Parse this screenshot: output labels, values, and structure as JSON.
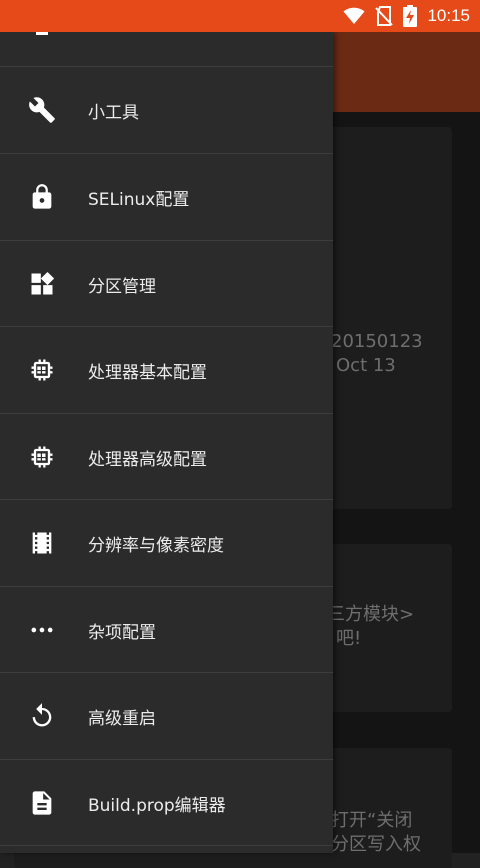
{
  "status_bar": {
    "time": "10:15",
    "icons": [
      "wifi-icon",
      "no-sim-icon",
      "battery-charging-icon"
    ],
    "color": "#e64a19"
  },
  "background": {
    "card1_lines": [
      "20150123",
      "Oct 13"
    ],
    "card2_lines": [
      "三方模块>",
      "吧!"
    ],
    "card3_lines": [
      "打开“关闭",
      "分区写入权"
    ]
  },
  "drawer": {
    "items": [
      {
        "label": "小工具",
        "icon": "wrench-icon"
      },
      {
        "label": "SELinux配置",
        "icon": "lock-icon"
      },
      {
        "label": "分区管理",
        "icon": "widgets-icon"
      },
      {
        "label": "处理器基本配置",
        "icon": "chip-icon"
      },
      {
        "label": "处理器高级配置",
        "icon": "chip-icon"
      },
      {
        "label": "分辨率与像素密度",
        "icon": "film-icon"
      },
      {
        "label": "杂项配置",
        "icon": "more-dots-icon"
      },
      {
        "label": "高级重启",
        "icon": "restart-icon"
      },
      {
        "label": "Build.prop编辑器",
        "icon": "document-icon"
      }
    ]
  }
}
